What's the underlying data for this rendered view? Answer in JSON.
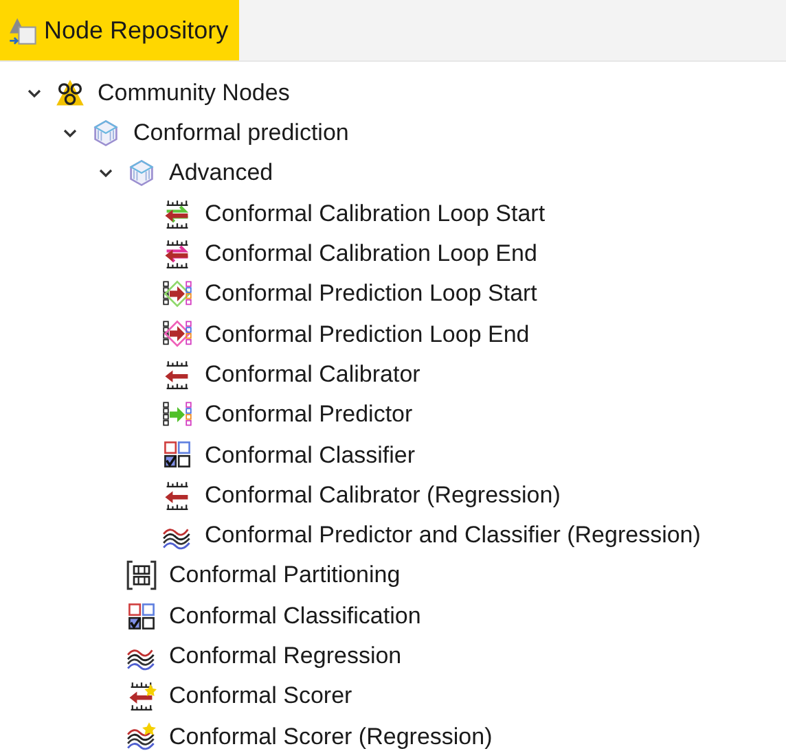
{
  "panel": {
    "title": "Node Repository",
    "selected": true
  },
  "tree": [
    {
      "label": "Community Nodes",
      "kind": "community",
      "expanded": true,
      "children": [
        {
          "label": "Conformal prediction",
          "kind": "category",
          "expanded": true,
          "children": [
            {
              "label": "Advanced",
              "kind": "category",
              "expanded": true,
              "children": [
                {
                  "label": "Conformal Calibration Loop Start",
                  "kind": "loop-start"
                },
                {
                  "label": "Conformal Calibration Loop End",
                  "kind": "loop-end"
                },
                {
                  "label": "Conformal Prediction Loop Start",
                  "kind": "pred-loop-start"
                },
                {
                  "label": "Conformal Prediction Loop End",
                  "kind": "pred-loop-end"
                },
                {
                  "label": "Conformal Calibrator",
                  "kind": "calibrator"
                },
                {
                  "label": "Conformal Predictor",
                  "kind": "predictor"
                },
                {
                  "label": "Conformal Classifier",
                  "kind": "classifier"
                },
                {
                  "label": "Conformal Calibrator (Regression)",
                  "kind": "calibrator"
                },
                {
                  "label": "Conformal Predictor and Classifier (Regression)",
                  "kind": "regression"
                }
              ]
            },
            {
              "label": "Conformal Partitioning",
              "kind": "partitioning"
            },
            {
              "label": "Conformal Classification",
              "kind": "classifier"
            },
            {
              "label": "Conformal Regression",
              "kind": "regression"
            },
            {
              "label": "Conformal Scorer",
              "kind": "scorer"
            },
            {
              "label": "Conformal Scorer (Regression)",
              "kind": "scorer-regression"
            }
          ]
        }
      ]
    }
  ]
}
